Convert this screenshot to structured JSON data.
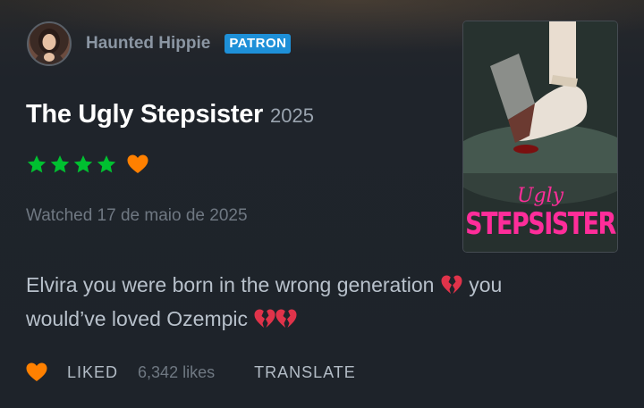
{
  "header": {
    "username": "Haunted Hippie",
    "badge": "PATRON"
  },
  "review": {
    "film_title": "The Ugly Stepsister",
    "year": "2025",
    "rating_stars": 4,
    "rating_heart": true,
    "watched_text": "Watched 17 de maio de 2025",
    "body_line1": "Elvira you were born in the wrong generation",
    "body_line1b": "you",
    "body_line2": "would’ve loved Ozempic",
    "emoji": "broken-heart"
  },
  "poster": {
    "title_small": "Ugly",
    "title_big": "STEPSISTER"
  },
  "footer": {
    "liked_label": "LIKED",
    "likes_count": "6,342 likes",
    "translate_label": "TRANSLATE"
  },
  "colors": {
    "star_green": "#00c030",
    "heart_orange": "#ff8000",
    "badge_blue": "#1e90d8",
    "poster_pink": "#ff2d9a"
  }
}
